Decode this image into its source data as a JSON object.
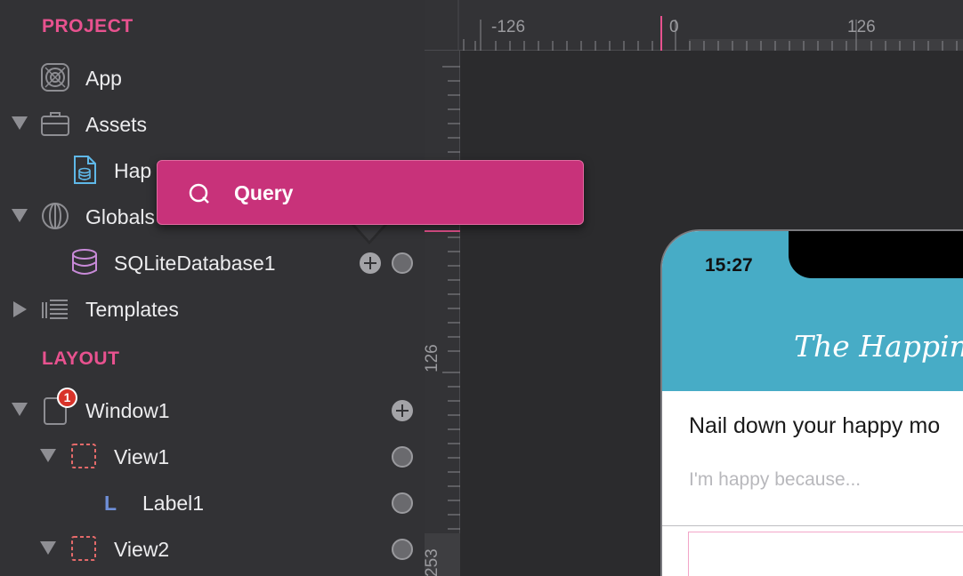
{
  "sidebar": {
    "project_title": "PROJECT",
    "layout_title": "LAYOUT",
    "project_items": [
      {
        "label": "App",
        "icon": "app-icon"
      },
      {
        "label": "Assets",
        "icon": "briefcase-icon"
      },
      {
        "label": "Hap",
        "icon": "document-database-icon"
      },
      {
        "label": "Globals",
        "icon": "globe-icon"
      },
      {
        "label": "SQLiteDatabase1",
        "icon": "database-icon"
      },
      {
        "label": "Templates",
        "icon": "templates-icon"
      }
    ],
    "layout_items": [
      {
        "label": "Window1",
        "icon": "window-icon",
        "badge": "1"
      },
      {
        "label": "View1",
        "icon": "view-icon"
      },
      {
        "label": "Label1",
        "icon": "label-l-icon",
        "glyph": "L"
      },
      {
        "label": "View2",
        "icon": "view-icon"
      }
    ]
  },
  "ruler": {
    "h_labels": [
      "-126",
      "0",
      "126"
    ],
    "v_labels": [
      "126",
      "253"
    ]
  },
  "popover": {
    "query_label": "Query"
  },
  "phone": {
    "time": "15:27",
    "app_title": "The Happine",
    "question": "Nail down your happy mo",
    "input_placeholder": "I'm happy because..."
  },
  "colors": {
    "accent": "#e8528f",
    "popover": "#c8327a",
    "header": "#47acc6",
    "badge": "#d8332a"
  }
}
